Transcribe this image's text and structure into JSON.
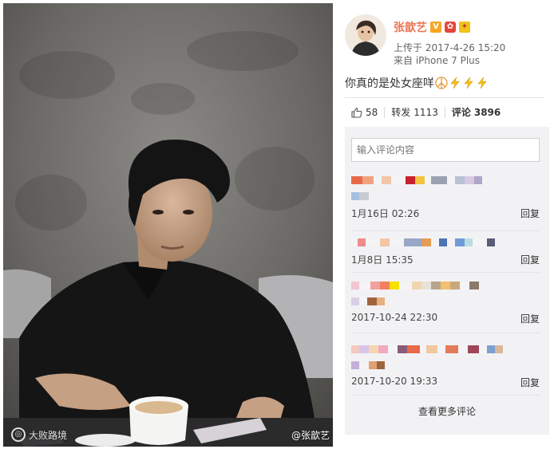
{
  "photo": {
    "watermark_left": "大败路境",
    "watermark_right": "@张歆艺"
  },
  "post": {
    "author": "张歆艺",
    "badges": [
      "V",
      "✿",
      "✦"
    ],
    "uploaded": "上传于 2017-4-26 15:20",
    "source": "来自 iPhone 7 Plus",
    "text": "你真的是处女座咩",
    "emojis": [
      "peace-icon",
      "lightning-icon",
      "lightning-icon",
      "lightning-icon"
    ]
  },
  "actions": {
    "likes": "58",
    "repost_label": "转发",
    "repost_count": "1113",
    "comment_label": "评论",
    "comment_count": "3896"
  },
  "comments": {
    "input_placeholder": "输入评论内容",
    "reply_label": "回复",
    "more_label": "查看更多评论",
    "items": [
      {
        "time": "1月16日 02:26"
      },
      {
        "time": "1月8日 15:35"
      },
      {
        "time": "2017-10-24 22:30"
      },
      {
        "time": "2017-10-20 19:33"
      }
    ]
  },
  "colors": {
    "accent": "#eb7350",
    "panel_bg": "#f2f2f5"
  }
}
